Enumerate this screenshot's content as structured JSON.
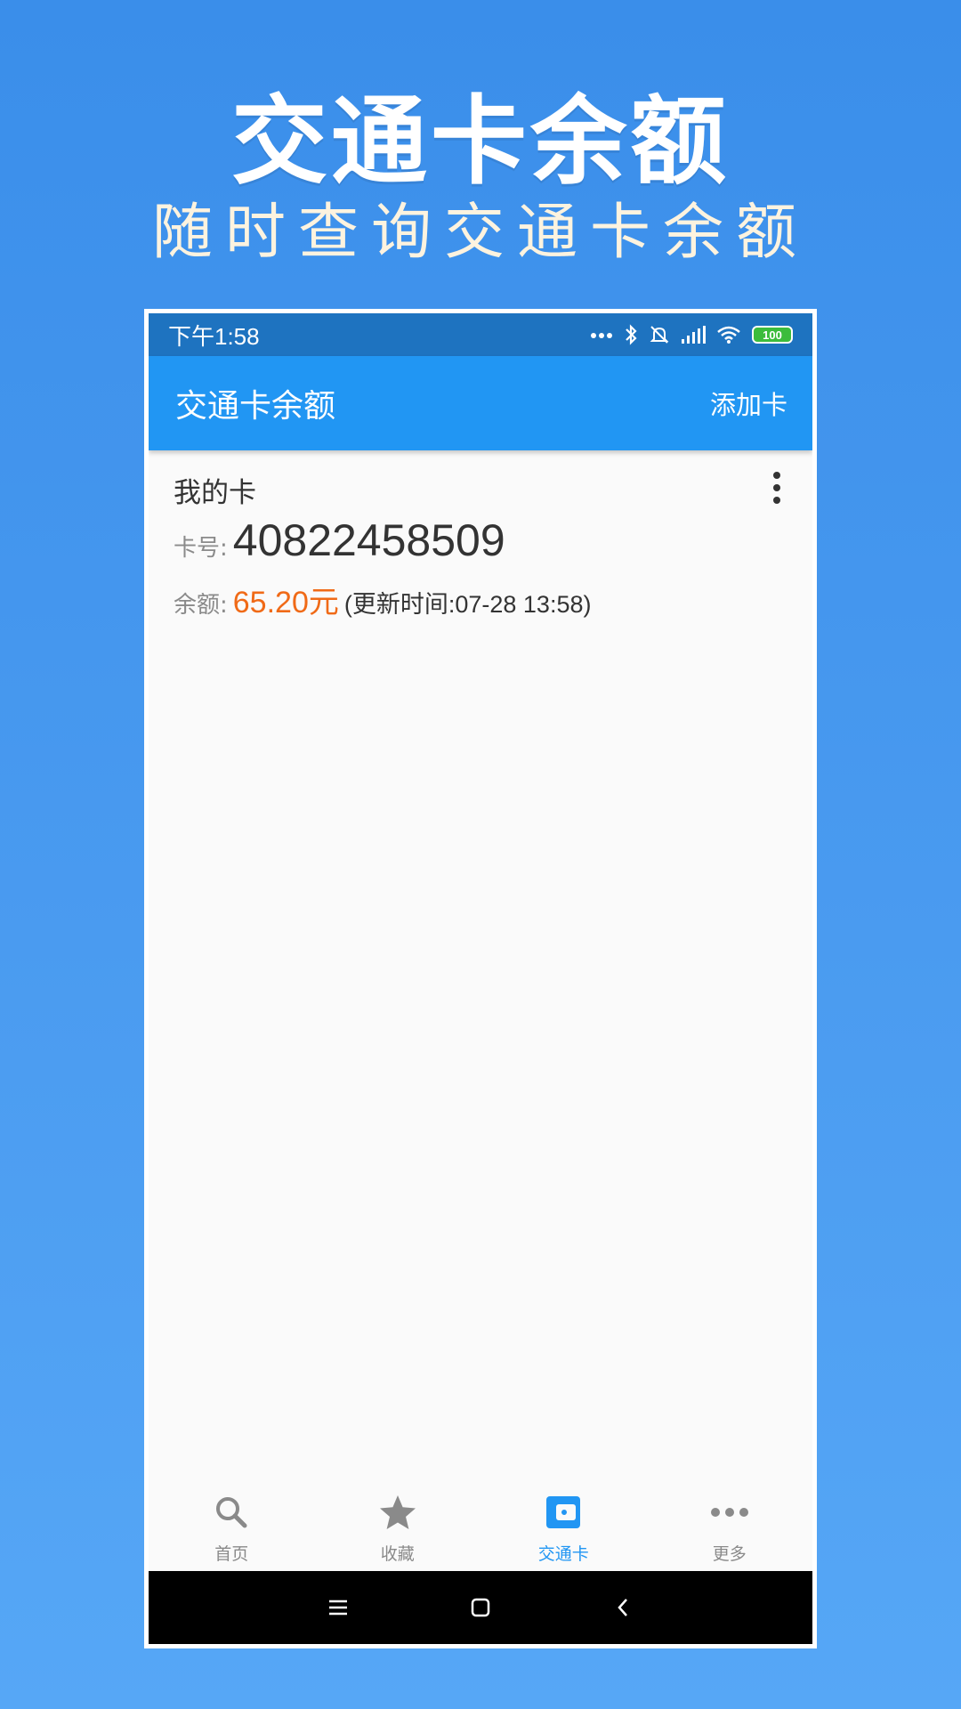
{
  "promo": {
    "title": "交通卡余额",
    "subtitle": "随时查询交通卡余额"
  },
  "status_bar": {
    "time": "下午1:58",
    "battery": "100",
    "icons": [
      "more-dots-icon",
      "bluetooth-icon",
      "mute-bell-icon",
      "signal-icon",
      "wifi-icon",
      "battery-icon"
    ]
  },
  "app_bar": {
    "title": "交通卡余额",
    "action_label": "添加卡"
  },
  "card": {
    "name": "我的卡",
    "number_label": "卡号:",
    "number": "40822458509",
    "balance_label": "余额:",
    "balance": "65.20元",
    "update_time": "(更新时间:07-28 13:58)"
  },
  "bottom_nav": {
    "tabs": [
      {
        "label": "首页",
        "icon": "search-icon"
      },
      {
        "label": "收藏",
        "icon": "star-icon"
      },
      {
        "label": "交通卡",
        "icon": "wallet-icon",
        "active": true
      },
      {
        "label": "更多",
        "icon": "more-horizontal-icon"
      }
    ]
  },
  "colors": {
    "app_bar": "#2196f3",
    "status_bar": "#1e73c0",
    "balance": "#f06a17",
    "active_tab": "#2196f3",
    "inactive_tab": "#8a8a8a"
  }
}
